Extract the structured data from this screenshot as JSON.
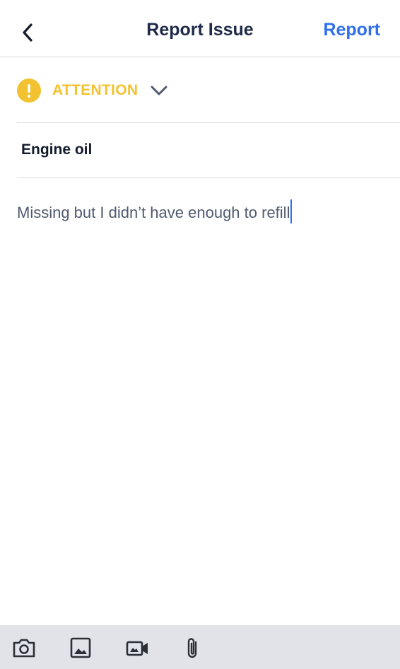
{
  "header": {
    "title": "Report Issue",
    "action_label": "Report",
    "back_icon": "chevron-left-icon"
  },
  "severity": {
    "label": "ATTENTION",
    "icon": "alert-circle-icon",
    "color": "#F2C230",
    "dropdown_icon": "chevron-down-icon"
  },
  "item": {
    "name": "Engine oil"
  },
  "description": {
    "value": "Missing but I didn’t have enough to refill"
  },
  "toolbar": {
    "tools": [
      "camera-icon",
      "image-icon",
      "video-camera-icon",
      "paperclip-icon"
    ]
  },
  "colors": {
    "accent": "#2F6FEC",
    "title_text": "#1F2A4A",
    "toolbar_bg": "#E2E3E8"
  }
}
